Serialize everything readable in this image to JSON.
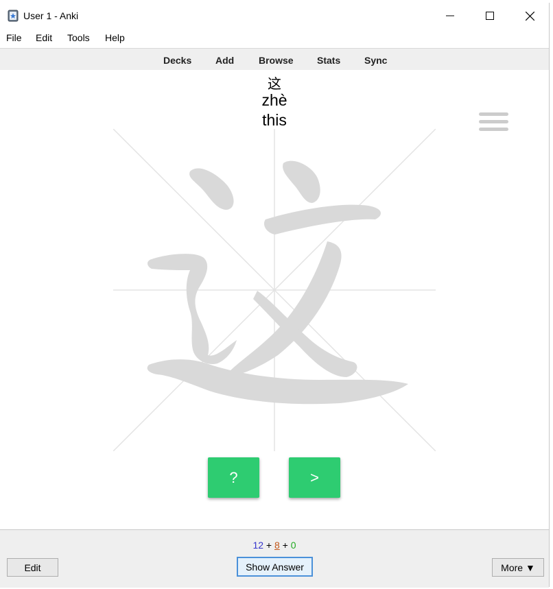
{
  "window": {
    "title": "User 1 - Anki",
    "controls": {
      "minimize": "minimize-icon",
      "maximize": "maximize-icon",
      "close": "close-icon"
    }
  },
  "menu": [
    "File",
    "Edit",
    "Tools",
    "Help"
  ],
  "toolbar": [
    "Decks",
    "Add",
    "Browse",
    "Stats",
    "Sync"
  ],
  "card": {
    "character": "这",
    "pinyin": "zhè",
    "meaning": "this",
    "stroke_color": "#d9d9d9",
    "grid_color": "#e3e3e3",
    "hint_button": "?",
    "next_button": ">",
    "button_color": "#2ecc71"
  },
  "counts": {
    "new": "12",
    "learning": "8",
    "review": "0",
    "sep": "+"
  },
  "bottom": {
    "edit": "Edit",
    "show_answer": "Show Answer",
    "more": "More ▼"
  }
}
